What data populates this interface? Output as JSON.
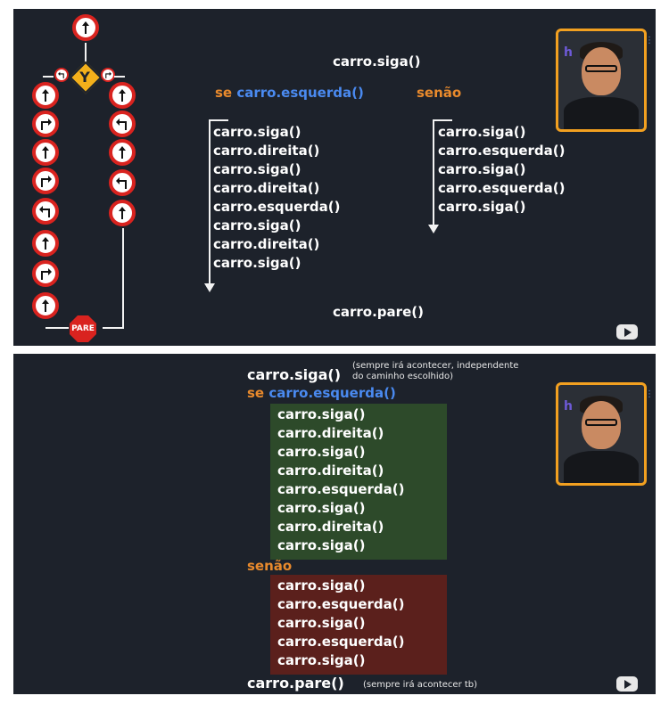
{
  "slide1": {
    "top_call": "carro.siga()",
    "if_keyword": "se",
    "if_condition": "carro.esquerda()",
    "else_keyword": "senão",
    "left_branch": [
      "carro.siga()",
      "carro.direita()",
      "carro.siga()",
      "carro.direita()",
      "carro.esquerda()",
      "carro.siga()",
      "carro.direita()",
      "carro.siga()"
    ],
    "right_branch": [
      "carro.siga()",
      "carro.esquerda()",
      "carro.siga()",
      "carro.esquerda()",
      "carro.siga()"
    ],
    "bottom_call": "carro.pare()",
    "diagram": {
      "stop_label": "PARE",
      "left_signs": [
        "straight-arrow-icon",
        "right-turn-icon",
        "straight-arrow-icon",
        "right-turn-icon",
        "left-turn-icon",
        "straight-arrow-icon",
        "right-turn-icon",
        "straight-arrow-icon"
      ],
      "right_signs": [
        "straight-arrow-icon",
        "left-turn-icon",
        "straight-arrow-icon",
        "left-turn-icon",
        "straight-arrow-icon"
      ]
    }
  },
  "slide2": {
    "top_call": "carro.siga()",
    "top_note": "(sempre irá acontecer, independente do caminho escolhido)",
    "top_note_line1": "(sempre irá acontecer, independente",
    "top_note_line2": "do caminho escolhido)",
    "if_keyword": "se",
    "if_condition": "carro.esquerda()",
    "if_block": [
      "carro.siga()",
      "carro.direita()",
      "carro.siga()",
      "carro.direita()",
      "carro.esquerda()",
      "carro.siga()",
      "carro.direita()",
      "carro.siga()"
    ],
    "else_keyword": "senão",
    "else_block": [
      "carro.siga()",
      "carro.esquerda()",
      "carro.siga()",
      "carro.esquerda()",
      "carro.siga()"
    ],
    "bottom_call": "carro.pare()",
    "bottom_note": "(sempre irá acontecer tb)"
  },
  "colors": {
    "background": "#1d222b",
    "keyword": "#e98a2c",
    "condition": "#4a8af0",
    "if_block": "#2d4a2a",
    "else_block": "#5b201c",
    "sign_border": "#d9231f",
    "webcam_border": "#f2a020"
  },
  "icons": [
    "straight-arrow-icon",
    "right-turn-icon",
    "left-turn-icon",
    "fork-sign-icon",
    "stop-sign-icon",
    "youtube-icon"
  ]
}
